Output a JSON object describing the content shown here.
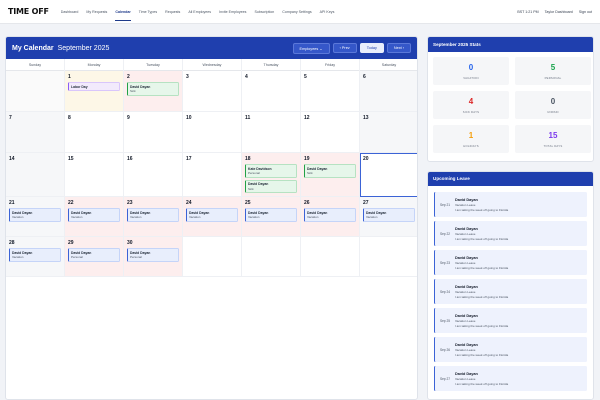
{
  "nav": {
    "logo": "TIME OFF",
    "items": [
      "Dashboard",
      "My Requests",
      "Calendar",
      "Time Types",
      "Requests",
      "All Employees",
      "Invite Employees",
      "Subscription",
      "Company Settings",
      "API Keys"
    ],
    "active_index": 2,
    "right": [
      "BST 1:21 PM",
      "Taylor Dashboard",
      "Sign out"
    ]
  },
  "calendar": {
    "title": "My Calendar",
    "month": "September 2025",
    "employees_btn": "Employees",
    "prev_btn": "‹ Prev",
    "today_btn": "Today",
    "next_btn": "Next ›",
    "day_names": [
      "Sunday",
      "Monday",
      "Tuesday",
      "Wednesday",
      "Thursday",
      "Friday",
      "Saturday"
    ],
    "cells": [
      {
        "day": "",
        "style": "empty",
        "events": []
      },
      {
        "day": "1",
        "style": "holiday",
        "events": [
          {
            "name": "Labor Day",
            "type": "",
            "color": "purple"
          }
        ]
      },
      {
        "day": "2",
        "style": "leaveday",
        "events": [
          {
            "name": "David Dayan",
            "type": "Sick",
            "color": "green"
          }
        ]
      },
      {
        "day": "3",
        "style": "",
        "events": []
      },
      {
        "day": "4",
        "style": "",
        "events": []
      },
      {
        "day": "5",
        "style": "",
        "events": []
      },
      {
        "day": "6",
        "style": "weekend",
        "events": []
      },
      {
        "day": "7",
        "style": "weekend",
        "events": []
      },
      {
        "day": "8",
        "style": "",
        "events": []
      },
      {
        "day": "9",
        "style": "",
        "events": []
      },
      {
        "day": "10",
        "style": "",
        "events": []
      },
      {
        "day": "11",
        "style": "",
        "events": []
      },
      {
        "day": "12",
        "style": "",
        "events": []
      },
      {
        "day": "13",
        "style": "weekend",
        "events": []
      },
      {
        "day": "14",
        "style": "weekend",
        "events": []
      },
      {
        "day": "15",
        "style": "",
        "events": []
      },
      {
        "day": "16",
        "style": "",
        "events": []
      },
      {
        "day": "17",
        "style": "",
        "events": []
      },
      {
        "day": "18",
        "style": "leaveday",
        "events": [
          {
            "name": "Kate Davidson",
            "type": "Personal",
            "color": "green"
          },
          {
            "name": "David Dayan",
            "type": "Sick",
            "color": "green"
          }
        ]
      },
      {
        "day": "19",
        "style": "leaveday",
        "events": [
          {
            "name": "David Dayan",
            "type": "Sick",
            "color": "green"
          }
        ]
      },
      {
        "day": "20",
        "style": "today",
        "events": []
      },
      {
        "day": "21",
        "style": "weekend",
        "events": [
          {
            "name": "David Dayan",
            "type": "Vacation",
            "color": "blue"
          }
        ]
      },
      {
        "day": "22",
        "style": "leaveday",
        "events": [
          {
            "name": "David Dayan",
            "type": "Vacation",
            "color": "blue"
          }
        ]
      },
      {
        "day": "23",
        "style": "leaveday",
        "events": [
          {
            "name": "David Dayan",
            "type": "Vacation",
            "color": "blue"
          }
        ]
      },
      {
        "day": "24",
        "style": "leaveday",
        "events": [
          {
            "name": "David Dayan",
            "type": "Vacation",
            "color": "blue"
          }
        ]
      },
      {
        "day": "25",
        "style": "leaveday",
        "events": [
          {
            "name": "David Dayan",
            "type": "Vacation",
            "color": "blue"
          }
        ]
      },
      {
        "day": "26",
        "style": "leaveday",
        "events": [
          {
            "name": "David Dayan",
            "type": "Vacation",
            "color": "blue"
          }
        ]
      },
      {
        "day": "27",
        "style": "weekend",
        "events": [
          {
            "name": "David Dayan",
            "type": "Vacation",
            "color": "blue"
          }
        ]
      },
      {
        "day": "28",
        "style": "weekend",
        "events": [
          {
            "name": "David Dayan",
            "type": "Vacation",
            "color": "blue"
          }
        ]
      },
      {
        "day": "29",
        "style": "leaveday",
        "events": [
          {
            "name": "David Dayan",
            "type": "Personal",
            "color": "blue"
          }
        ]
      },
      {
        "day": "30",
        "style": "leaveday",
        "events": [
          {
            "name": "David Dayan",
            "type": "Personal",
            "color": "blue"
          }
        ]
      },
      {
        "day": "",
        "style": "",
        "events": []
      },
      {
        "day": "",
        "style": "",
        "events": []
      },
      {
        "day": "",
        "style": "",
        "events": []
      },
      {
        "day": "",
        "style": "",
        "events": []
      }
    ]
  },
  "stats": {
    "title": "September 2025 Stats",
    "items": [
      {
        "value": "0",
        "label": "VACATION",
        "color": "#2563eb"
      },
      {
        "value": "5",
        "label": "PERSONAL",
        "color": "#16a34a"
      },
      {
        "value": "4",
        "label": "SICK DAYS",
        "color": "#dc2626"
      },
      {
        "value": "0",
        "label": "UNPAID",
        "color": "#4b5563"
      },
      {
        "value": "1",
        "label": "HOLIDAYS",
        "color": "#f59e0b"
      },
      {
        "value": "15",
        "label": "TOTAL DAYS",
        "color": "#7c3aed"
      }
    ]
  },
  "upcoming": {
    "title": "Upcoming Leave",
    "items": [
      {
        "date": "Sep 21",
        "name": "David Dayan",
        "type": "Vacation Leave",
        "note": "I am taking the week off going to Florida"
      },
      {
        "date": "Sep 22",
        "name": "David Dayan",
        "type": "Vacation Leave",
        "note": "I am taking the week off going to Florida"
      },
      {
        "date": "Sep 23",
        "name": "David Dayan",
        "type": "Vacation Leave",
        "note": "I am taking the week off going to Florida"
      },
      {
        "date": "Sep 24",
        "name": "David Dayan",
        "type": "Vacation Leave",
        "note": "I am taking the week off going to Florida"
      },
      {
        "date": "Sep 25",
        "name": "David Dayan",
        "type": "Vacation Leave",
        "note": "I am taking the week off going to Florida"
      },
      {
        "date": "Sep 26",
        "name": "David Dayan",
        "type": "Vacation Leave",
        "note": "I am taking the week off going to Florida"
      },
      {
        "date": "Sep 27",
        "name": "David Dayan",
        "type": "Vacation Leave",
        "note": "I am taking the week off going to Florida"
      }
    ]
  }
}
